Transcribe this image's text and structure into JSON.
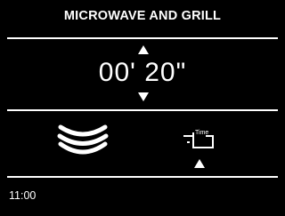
{
  "header": {
    "title": "MICROWAVE  AND GRILL"
  },
  "timer": {
    "value": "00' 20\""
  },
  "controls": {
    "left_icon": "microwave-waves-icon",
    "right_icon": "grill-mode-time-icon",
    "right_icon_text": "Time"
  },
  "status": {
    "clock": "11:00"
  }
}
